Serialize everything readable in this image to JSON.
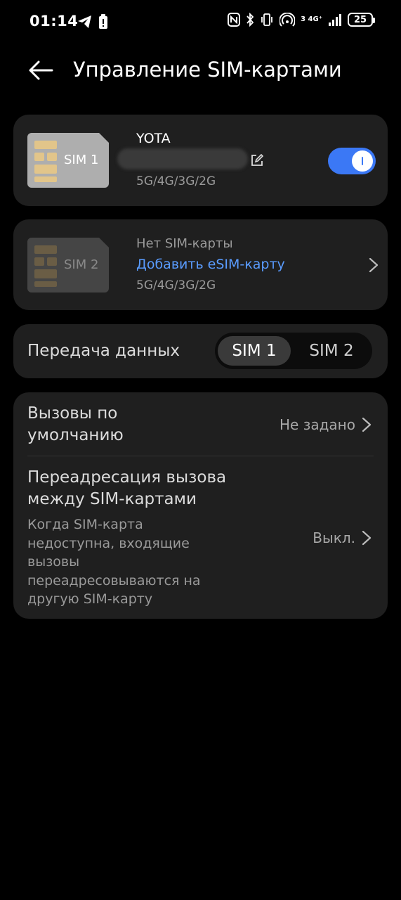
{
  "status_bar": {
    "time": "01:14",
    "network_label_top": "3 4G⁺",
    "battery": "25"
  },
  "header": {
    "title": "Управление SIM-картами"
  },
  "sim1": {
    "chip_label": "SIM 1",
    "operator": "YOTA",
    "networks": "5G/4G/3G/2G",
    "enabled": true,
    "accent_color": "#3b78f5"
  },
  "sim2": {
    "chip_label": "SIM 2",
    "status": "Нет SIM-карты",
    "add_esim": "Добавить eSIM-карту",
    "networks": "5G/4G/3G/2G",
    "link_color": "#5a9cff"
  },
  "data_transfer": {
    "label": "Передача данных",
    "options": [
      "SIM 1",
      "SIM 2"
    ],
    "selected": "SIM 1"
  },
  "default_calls": {
    "label": "Вызовы по умолчанию",
    "value": "Не задано"
  },
  "call_forwarding": {
    "label": "Переадресация вызова между SIM-картами",
    "description": "Когда SIM-карта недоступна, входящие вызовы переадресовываются на другую SIM-карту",
    "value": "Выкл."
  }
}
